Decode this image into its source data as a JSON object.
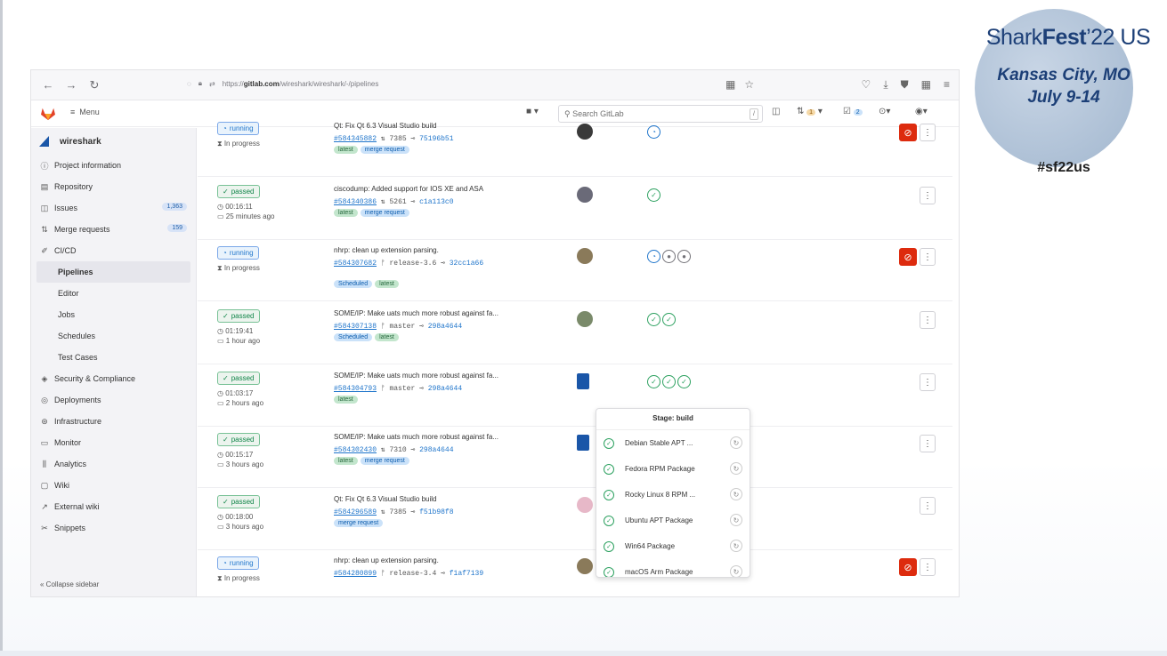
{
  "branding": {
    "title_a": "Shark",
    "title_b": "Fest",
    "title_c": "’22 US",
    "city": "Kansas City, MO",
    "dates": "July 9-14",
    "hashtag": "#sf22us"
  },
  "browser": {
    "url_prefix": "https://",
    "url_host": "gitlab.com",
    "url_path": "/wireshark/wireshark/-/pipelines"
  },
  "header": {
    "menu_label": "Menu",
    "search_placeholder": "Search GitLab",
    "search_kbd": "/",
    "mr_count": "1",
    "todo_count": "2"
  },
  "sidebar": {
    "project": "wireshark",
    "items": [
      {
        "icon": "info-icon",
        "glyph": "ⓘ",
        "label": "Project information"
      },
      {
        "icon": "repository-icon",
        "glyph": "▤",
        "label": "Repository"
      },
      {
        "icon": "issues-icon",
        "glyph": "◫",
        "label": "Issues",
        "count": "1,363"
      },
      {
        "icon": "merge-request-icon",
        "glyph": "⇅",
        "label": "Merge requests",
        "count": "159"
      },
      {
        "icon": "rocket-icon",
        "glyph": "✐",
        "label": "CI/CD"
      }
    ],
    "cicd_sub": [
      "Pipelines",
      "Editor",
      "Jobs",
      "Schedules",
      "Test Cases"
    ],
    "items2": [
      {
        "icon": "shield-icon",
        "glyph": "◈",
        "label": "Security & Compliance"
      },
      {
        "icon": "deployments-icon",
        "glyph": "◎",
        "label": "Deployments"
      },
      {
        "icon": "infrastructure-icon",
        "glyph": "⊛",
        "label": "Infrastructure"
      },
      {
        "icon": "monitor-icon",
        "glyph": "▭",
        "label": "Monitor"
      },
      {
        "icon": "analytics-icon",
        "glyph": "⫼",
        "label": "Analytics"
      },
      {
        "icon": "wiki-icon",
        "glyph": "▢",
        "label": "Wiki"
      },
      {
        "icon": "external-link-icon",
        "glyph": "↗",
        "label": "External wiki"
      },
      {
        "icon": "snippets-icon",
        "glyph": "✂",
        "label": "Snippets"
      }
    ],
    "collapse": "« Collapse sidebar"
  },
  "pipelines": [
    {
      "status": "running",
      "meta1": "⧗ In progress",
      "meta2": "",
      "title": "Qt: Fix Qt 6.3 Visual Studio build",
      "id": "#584345882",
      "ref_icon": "⇅",
      "ref": "7385",
      "sha": "75196b51",
      "tags": [
        "latest",
        "merge request"
      ],
      "stages": [
        "run"
      ],
      "cancel": true
    },
    {
      "status": "passed",
      "meta1": "◷ 00:16:11",
      "meta2": "▭ 25 minutes ago",
      "title": "ciscodump: Added support for IOS XE and ASA",
      "id": "#584340386",
      "ref_icon": "⇅",
      "ref": "5261",
      "sha": "c1a113c0",
      "tags": [
        "latest",
        "merge request"
      ],
      "stages": [
        "pass"
      ],
      "cancel": false
    },
    {
      "status": "running",
      "meta1": "⧗ In progress",
      "meta2": "",
      "title": "nhrp: clean up extension parsing.",
      "id": "#584307682",
      "ref_icon": "ᚠ",
      "ref": "release-3.6",
      "sha": "32cc1a66",
      "tags": [
        "Scheduled",
        "latest"
      ],
      "stages": [
        "run",
        "created",
        "created"
      ],
      "cancel": true
    },
    {
      "status": "passed",
      "meta1": "◷ 01:19:41",
      "meta2": "▭ 1 hour ago",
      "title": "SOME/IP: Make uats much more robust against fa...",
      "id": "#584307138",
      "ref_icon": "ᚠ",
      "ref": "master",
      "sha": "298a4644",
      "tags": [
        "Scheduled",
        "latest"
      ],
      "stages": [
        "pass",
        "pass"
      ],
      "cancel": false
    },
    {
      "status": "passed",
      "meta1": "◷ 01:03:17",
      "meta2": "▭ 2 hours ago",
      "title": "SOME/IP: Make uats much more robust against fa...",
      "id": "#584304793",
      "ref_icon": "ᚠ",
      "ref": "master",
      "sha": "298a4644",
      "tags": [
        "latest"
      ],
      "stages": [
        "pass",
        "pass",
        "pass"
      ],
      "cancel": false
    },
    {
      "status": "passed",
      "meta1": "◷ 00:15:17",
      "meta2": "▭ 3 hours ago",
      "title": "SOME/IP: Make uats much more robust against fa...",
      "id": "#584302430",
      "ref_icon": "⇅",
      "ref": "7310",
      "sha": "298a4644",
      "tags": [
        "latest",
        "merge request"
      ],
      "stages": [],
      "cancel": false
    },
    {
      "status": "passed",
      "meta1": "◷ 00:18:00",
      "meta2": "▭ 3 hours ago",
      "title": "Qt: Fix Qt 6.3 Visual Studio build",
      "id": "#584296589",
      "ref_icon": "⇅",
      "ref": "7385",
      "sha": "f51b98f8",
      "tags": [
        "merge request"
      ],
      "stages": [],
      "cancel": false
    },
    {
      "status": "running",
      "meta1": "⧗ In progress",
      "meta2": "",
      "title": "nhrp: clean up extension parsing.",
      "id": "#584280899",
      "ref_icon": "ᚠ",
      "ref": "release-3.4",
      "sha": "f1af7139",
      "tags": [],
      "stages": [
        "pass",
        "pass",
        "run"
      ],
      "cancel": true
    }
  ],
  "stage_dropdown": {
    "title": "Stage: build",
    "jobs": [
      "Debian Stable APT ...",
      "Fedora RPM Package",
      "Rocky Linux 8 RPM ...",
      "Ubuntu APT Package",
      "Win64 Package",
      "macOS Arm Package"
    ]
  }
}
